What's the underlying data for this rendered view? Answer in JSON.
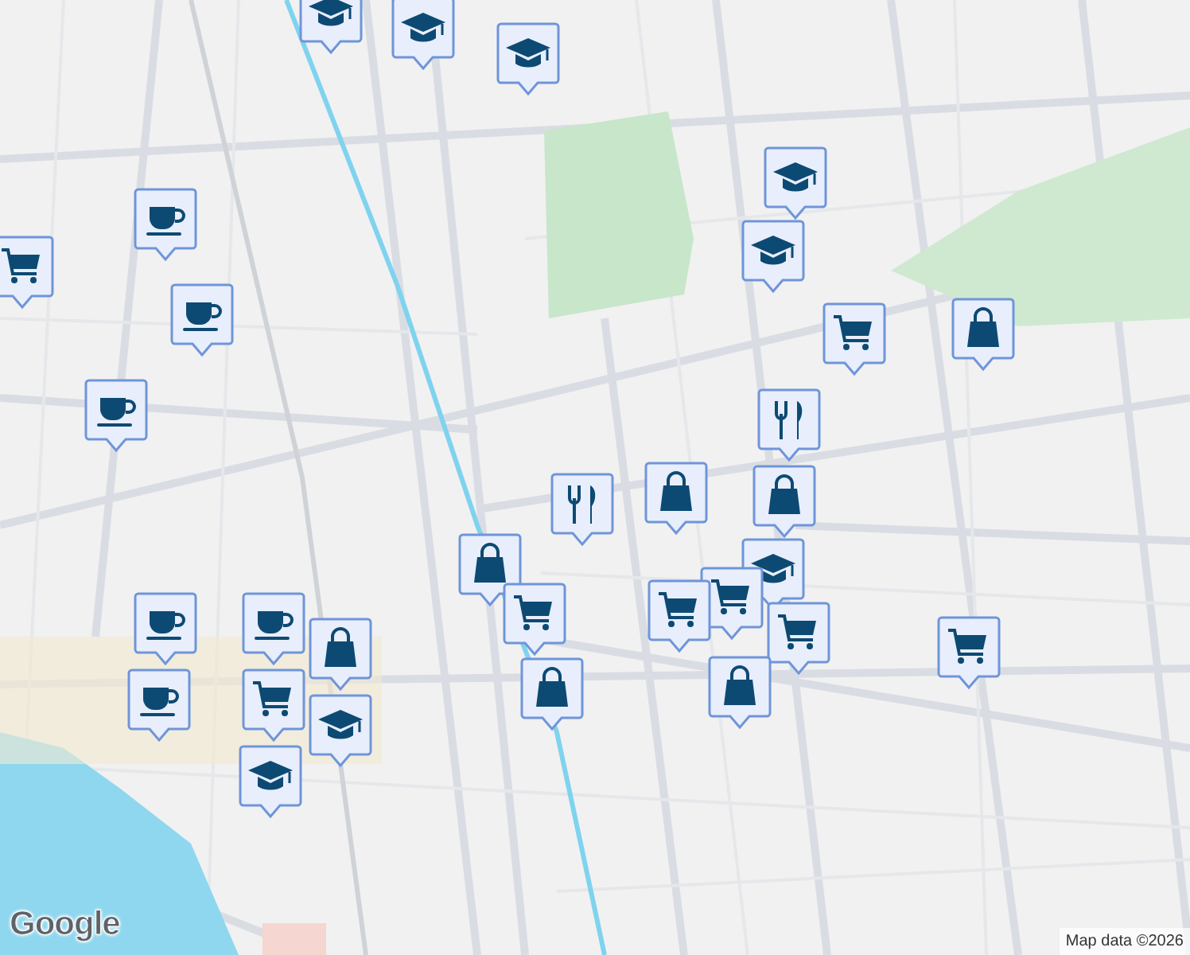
{
  "map": {
    "markers": [
      {
        "kind": "cap"
      },
      {
        "kind": "cap"
      },
      {
        "kind": "cap"
      },
      {
        "kind": "coffee"
      },
      {
        "kind": "coffee"
      },
      {
        "kind": "coffee"
      },
      {
        "kind": "cart"
      },
      {
        "kind": "cap"
      },
      {
        "kind": "cap"
      },
      {
        "kind": "cart"
      },
      {
        "kind": "bag"
      },
      {
        "kind": "food"
      },
      {
        "kind": "bag"
      },
      {
        "kind": "bag"
      },
      {
        "kind": "food"
      },
      {
        "kind": "bag"
      },
      {
        "kind": "cap"
      },
      {
        "kind": "cart"
      },
      {
        "kind": "cart"
      },
      {
        "kind": "cart"
      },
      {
        "kind": "cart"
      },
      {
        "kind": "cart"
      },
      {
        "kind": "bag"
      },
      {
        "kind": "bag"
      },
      {
        "kind": "coffee"
      },
      {
        "kind": "coffee"
      },
      {
        "kind": "bag"
      },
      {
        "kind": "coffee"
      },
      {
        "kind": "cap"
      },
      {
        "kind": "cart"
      },
      {
        "kind": "cap"
      }
    ]
  },
  "logo": "Google",
  "attribution": "Map data ©2026"
}
